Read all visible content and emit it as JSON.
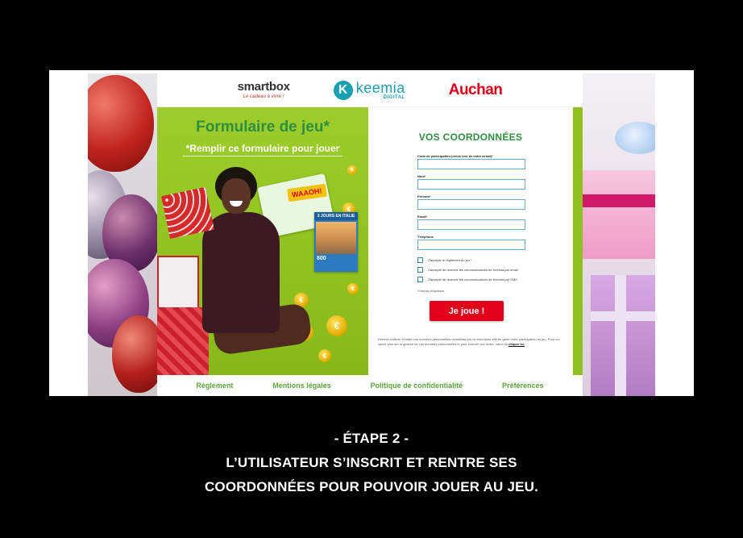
{
  "header": {
    "smartbox": "smartbox",
    "smartbox_tagline": "Le cadeau à vivre !",
    "keemia": "keemia",
    "keemia_sub": "DIGITAL",
    "auchan": "Auchan"
  },
  "promo": {
    "title": "Formulaire de jeu*",
    "subtitle": "*Remplir ce formulaire pour jouer",
    "wahoo": "WAAOH!",
    "box_label": "3 JOURS EN ITALIE",
    "box_number": "800"
  },
  "form": {
    "heading": "VOS COORDONNÉES",
    "fields": [
      {
        "label": "Code de participation (remis lors de votre achat)*",
        "value": ""
      },
      {
        "label": "Nom*",
        "value": ""
      },
      {
        "label": "Prénom*",
        "value": ""
      },
      {
        "label": "Email*",
        "value": ""
      },
      {
        "label": "Téléphone",
        "value": ""
      }
    ],
    "checkboxes": [
      "J'accepte le règlement du jeu *",
      "J'accepte de recevoir les communications de Keemia par email",
      "J'accepte de recevoir les communications de Keemia par SMS"
    ],
    "required_note": "*Champs obligatoires",
    "submit": "Je joue !",
    "legal": "Keemia collecte et traite vos données personnelles recueillies par ce formulaire afin de gérer votre participation au jeu. Pour en savoir plus sur la gestion de vos données personnelles et pour exercer vos droits, merci de",
    "legal_link": "cliquer ici."
  },
  "footer": {
    "links": [
      "Règlement",
      "Mentions légales",
      "Politique de confidentialité",
      "Préférences"
    ]
  },
  "caption": {
    "line1": "- ÉTAPE 2 -",
    "line2": "L’UTILISATEUR S’INSCRIT ET RENTRE SES",
    "line3": "COORDONNÉES POUR POUVOIR JOUER AU JEU."
  },
  "colors": {
    "accent_green": "#8fc21f",
    "title_green": "#2f8f3e",
    "button_red": "#e2001a",
    "keemia_blue": "#1a9fb3"
  }
}
